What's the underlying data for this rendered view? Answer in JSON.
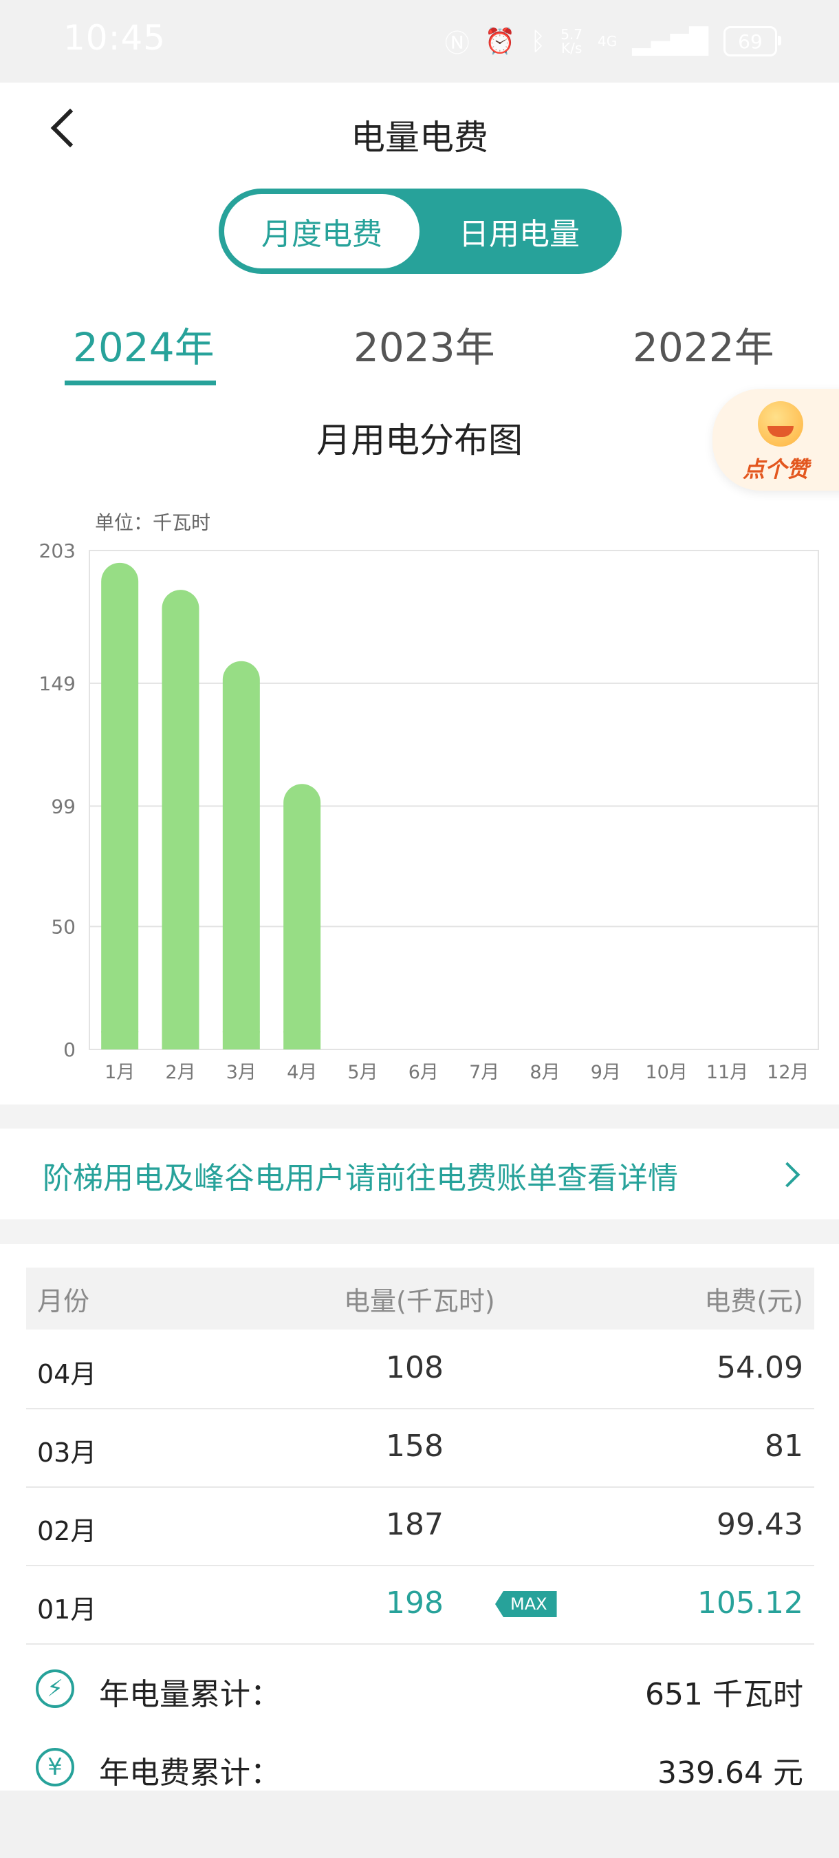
{
  "status_bar": {
    "time": "10:45",
    "net_speed_value": "5.7",
    "net_speed_unit": "K/s",
    "network": "4G",
    "battery": "69",
    "icons": [
      "nfc-icon",
      "alarm-icon",
      "bluetooth-icon",
      "signal-icon",
      "battery-icon"
    ]
  },
  "header": {
    "title": "电量电费",
    "back_icon": "chevron-left-icon"
  },
  "toggle": {
    "left_label": "月度电费",
    "right_label": "日用电量",
    "active": "left"
  },
  "year_tabs": [
    {
      "label": "2024年",
      "active": true
    },
    {
      "label": "2023年",
      "active": false
    },
    {
      "label": "2022年",
      "active": false
    }
  ],
  "chart_section": {
    "title": "月用电分布图",
    "unit_label": "单位：千瓦时"
  },
  "like_badge": {
    "label": "点个赞",
    "icon": "smiley-face-icon"
  },
  "chart_data": {
    "type": "bar",
    "categories": [
      "1月",
      "2月",
      "3月",
      "4月",
      "5月",
      "6月",
      "7月",
      "8月",
      "9月",
      "10月",
      "11月",
      "12月"
    ],
    "values": [
      198,
      187,
      158,
      108,
      null,
      null,
      null,
      null,
      null,
      null,
      null,
      null
    ],
    "y_ticks": [
      "0",
      "50",
      "99",
      "149",
      "203"
    ],
    "ylim": [
      0,
      203
    ],
    "ylabel": "单位：千瓦时",
    "grid": true,
    "colors": {
      "bar": "#97dd85",
      "grid": "#e3e3e3"
    }
  },
  "notice": {
    "text": "阶梯用电及峰谷电用户请前往电费账单查看详情",
    "arrow_icon": "chevron-right-icon"
  },
  "table": {
    "headers": {
      "month": "月份",
      "quantity": "电量(千瓦时)",
      "fee": "电费(元)"
    },
    "rows": [
      {
        "month": "04月",
        "quantity": "108",
        "fee": "54.09",
        "max": false
      },
      {
        "month": "03月",
        "quantity": "158",
        "fee": "81",
        "max": false
      },
      {
        "month": "02月",
        "quantity": "187",
        "fee": "99.43",
        "max": false
      },
      {
        "month": "01月",
        "quantity": "198",
        "fee": "105.12",
        "max": true
      }
    ],
    "max_tag": "MAX"
  },
  "summary": {
    "energy_label": "年电量累计：",
    "energy_value": "651 千瓦时",
    "energy_icon": "lightning-icon",
    "fee_label": "年电费累计：",
    "fee_value": "339.64 元",
    "fee_icon": "yen-icon"
  },
  "colors": {
    "accent": "#27a29a",
    "bar": "#97dd85"
  }
}
